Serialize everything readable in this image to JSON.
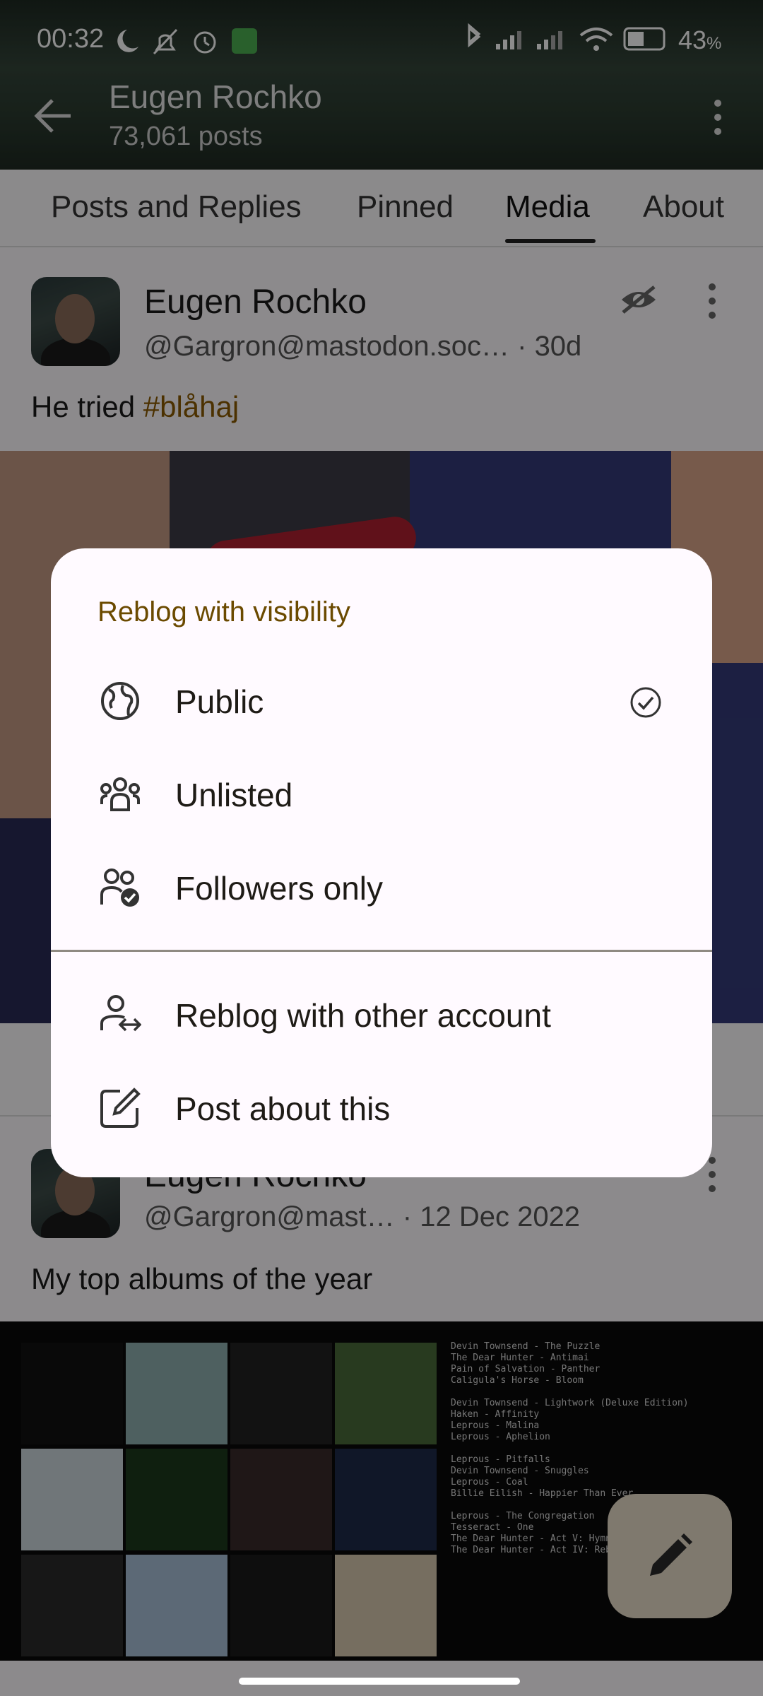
{
  "status_bar": {
    "time": "00:32",
    "battery": "43",
    "battery_unit": "%"
  },
  "header": {
    "name": "Eugen Rochko",
    "posts": "73,061 posts"
  },
  "tabs": [
    "Posts and Replies",
    "Pinned",
    "Media",
    "About"
  ],
  "active_tab": "Media",
  "post1": {
    "name": "Eugen Rochko",
    "handle": "@Gargron@mastodon.soc…",
    "sep": "·",
    "age": "30d",
    "text_prefix": "He tried ",
    "hashtag": "#blåhaj"
  },
  "post2": {
    "name": "Eugen Rochko",
    "handle": "@Gargron@mast…",
    "sep": "·",
    "age": "12 Dec 2022",
    "text": "My top albums of the year"
  },
  "tracklist": "Devin Townsend - The Puzzle\nThe Dear Hunter - Antimai\nPain of Salvation - Panther\nCaligula's Horse - Bloom\n\nDevin Townsend - Lightwork (Deluxe Edition)\nHaken - Affinity\nLeprous - Malina\nLeprous - Aphelion\n\nLeprous - Pitfalls\nDevin Townsend - Snuggles\nLeprous - Coal\nBillie Eilish - Happier Than Ever\n\nLeprous - The Congregation\nTesseract - One\nThe Dear Hunter - Act V: Hymns Wi… al\nThe Dear Hunter - Act IV: Rebirth…",
  "dialog": {
    "title": "Reblog with visibility",
    "options": [
      {
        "label": "Public",
        "icon": "globe-icon",
        "selected": true
      },
      {
        "label": "Unlisted",
        "icon": "people-icon",
        "selected": false
      },
      {
        "label": "Followers only",
        "icon": "followers-icon",
        "selected": false
      }
    ],
    "actions": [
      {
        "label": "Reblog with other account",
        "icon": "account-switch-icon"
      },
      {
        "label": "Post about this",
        "icon": "compose-icon"
      }
    ]
  },
  "colors": {
    "accent": "#6b4a00",
    "hashtag": "#8a5a00",
    "dialog_bg": "#fffaff"
  }
}
